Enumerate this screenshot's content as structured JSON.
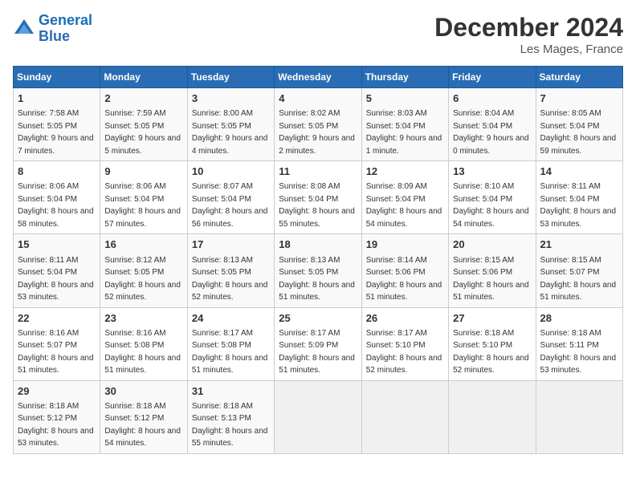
{
  "header": {
    "logo_line1": "General",
    "logo_line2": "Blue",
    "month": "December 2024",
    "location": "Les Mages, France"
  },
  "weekdays": [
    "Sunday",
    "Monday",
    "Tuesday",
    "Wednesday",
    "Thursday",
    "Friday",
    "Saturday"
  ],
  "weeks": [
    [
      {
        "day": "1",
        "sunrise": "Sunrise: 7:58 AM",
        "sunset": "Sunset: 5:05 PM",
        "daylight": "Daylight: 9 hours and 7 minutes."
      },
      {
        "day": "2",
        "sunrise": "Sunrise: 7:59 AM",
        "sunset": "Sunset: 5:05 PM",
        "daylight": "Daylight: 9 hours and 5 minutes."
      },
      {
        "day": "3",
        "sunrise": "Sunrise: 8:00 AM",
        "sunset": "Sunset: 5:05 PM",
        "daylight": "Daylight: 9 hours and 4 minutes."
      },
      {
        "day": "4",
        "sunrise": "Sunrise: 8:02 AM",
        "sunset": "Sunset: 5:05 PM",
        "daylight": "Daylight: 9 hours and 2 minutes."
      },
      {
        "day": "5",
        "sunrise": "Sunrise: 8:03 AM",
        "sunset": "Sunset: 5:04 PM",
        "daylight": "Daylight: 9 hours and 1 minute."
      },
      {
        "day": "6",
        "sunrise": "Sunrise: 8:04 AM",
        "sunset": "Sunset: 5:04 PM",
        "daylight": "Daylight: 9 hours and 0 minutes."
      },
      {
        "day": "7",
        "sunrise": "Sunrise: 8:05 AM",
        "sunset": "Sunset: 5:04 PM",
        "daylight": "Daylight: 8 hours and 59 minutes."
      }
    ],
    [
      {
        "day": "8",
        "sunrise": "Sunrise: 8:06 AM",
        "sunset": "Sunset: 5:04 PM",
        "daylight": "Daylight: 8 hours and 58 minutes."
      },
      {
        "day": "9",
        "sunrise": "Sunrise: 8:06 AM",
        "sunset": "Sunset: 5:04 PM",
        "daylight": "Daylight: 8 hours and 57 minutes."
      },
      {
        "day": "10",
        "sunrise": "Sunrise: 8:07 AM",
        "sunset": "Sunset: 5:04 PM",
        "daylight": "Daylight: 8 hours and 56 minutes."
      },
      {
        "day": "11",
        "sunrise": "Sunrise: 8:08 AM",
        "sunset": "Sunset: 5:04 PM",
        "daylight": "Daylight: 8 hours and 55 minutes."
      },
      {
        "day": "12",
        "sunrise": "Sunrise: 8:09 AM",
        "sunset": "Sunset: 5:04 PM",
        "daylight": "Daylight: 8 hours and 54 minutes."
      },
      {
        "day": "13",
        "sunrise": "Sunrise: 8:10 AM",
        "sunset": "Sunset: 5:04 PM",
        "daylight": "Daylight: 8 hours and 54 minutes."
      },
      {
        "day": "14",
        "sunrise": "Sunrise: 8:11 AM",
        "sunset": "Sunset: 5:04 PM",
        "daylight": "Daylight: 8 hours and 53 minutes."
      }
    ],
    [
      {
        "day": "15",
        "sunrise": "Sunrise: 8:11 AM",
        "sunset": "Sunset: 5:04 PM",
        "daylight": "Daylight: 8 hours and 53 minutes."
      },
      {
        "day": "16",
        "sunrise": "Sunrise: 8:12 AM",
        "sunset": "Sunset: 5:05 PM",
        "daylight": "Daylight: 8 hours and 52 minutes."
      },
      {
        "day": "17",
        "sunrise": "Sunrise: 8:13 AM",
        "sunset": "Sunset: 5:05 PM",
        "daylight": "Daylight: 8 hours and 52 minutes."
      },
      {
        "day": "18",
        "sunrise": "Sunrise: 8:13 AM",
        "sunset": "Sunset: 5:05 PM",
        "daylight": "Daylight: 8 hours and 51 minutes."
      },
      {
        "day": "19",
        "sunrise": "Sunrise: 8:14 AM",
        "sunset": "Sunset: 5:06 PM",
        "daylight": "Daylight: 8 hours and 51 minutes."
      },
      {
        "day": "20",
        "sunrise": "Sunrise: 8:15 AM",
        "sunset": "Sunset: 5:06 PM",
        "daylight": "Daylight: 8 hours and 51 minutes."
      },
      {
        "day": "21",
        "sunrise": "Sunrise: 8:15 AM",
        "sunset": "Sunset: 5:07 PM",
        "daylight": "Daylight: 8 hours and 51 minutes."
      }
    ],
    [
      {
        "day": "22",
        "sunrise": "Sunrise: 8:16 AM",
        "sunset": "Sunset: 5:07 PM",
        "daylight": "Daylight: 8 hours and 51 minutes."
      },
      {
        "day": "23",
        "sunrise": "Sunrise: 8:16 AM",
        "sunset": "Sunset: 5:08 PM",
        "daylight": "Daylight: 8 hours and 51 minutes."
      },
      {
        "day": "24",
        "sunrise": "Sunrise: 8:17 AM",
        "sunset": "Sunset: 5:08 PM",
        "daylight": "Daylight: 8 hours and 51 minutes."
      },
      {
        "day": "25",
        "sunrise": "Sunrise: 8:17 AM",
        "sunset": "Sunset: 5:09 PM",
        "daylight": "Daylight: 8 hours and 51 minutes."
      },
      {
        "day": "26",
        "sunrise": "Sunrise: 8:17 AM",
        "sunset": "Sunset: 5:10 PM",
        "daylight": "Daylight: 8 hours and 52 minutes."
      },
      {
        "day": "27",
        "sunrise": "Sunrise: 8:18 AM",
        "sunset": "Sunset: 5:10 PM",
        "daylight": "Daylight: 8 hours and 52 minutes."
      },
      {
        "day": "28",
        "sunrise": "Sunrise: 8:18 AM",
        "sunset": "Sunset: 5:11 PM",
        "daylight": "Daylight: 8 hours and 53 minutes."
      }
    ],
    [
      {
        "day": "29",
        "sunrise": "Sunrise: 8:18 AM",
        "sunset": "Sunset: 5:12 PM",
        "daylight": "Daylight: 8 hours and 53 minutes."
      },
      {
        "day": "30",
        "sunrise": "Sunrise: 8:18 AM",
        "sunset": "Sunset: 5:12 PM",
        "daylight": "Daylight: 8 hours and 54 minutes."
      },
      {
        "day": "31",
        "sunrise": "Sunrise: 8:18 AM",
        "sunset": "Sunset: 5:13 PM",
        "daylight": "Daylight: 8 hours and 55 minutes."
      },
      null,
      null,
      null,
      null
    ]
  ]
}
